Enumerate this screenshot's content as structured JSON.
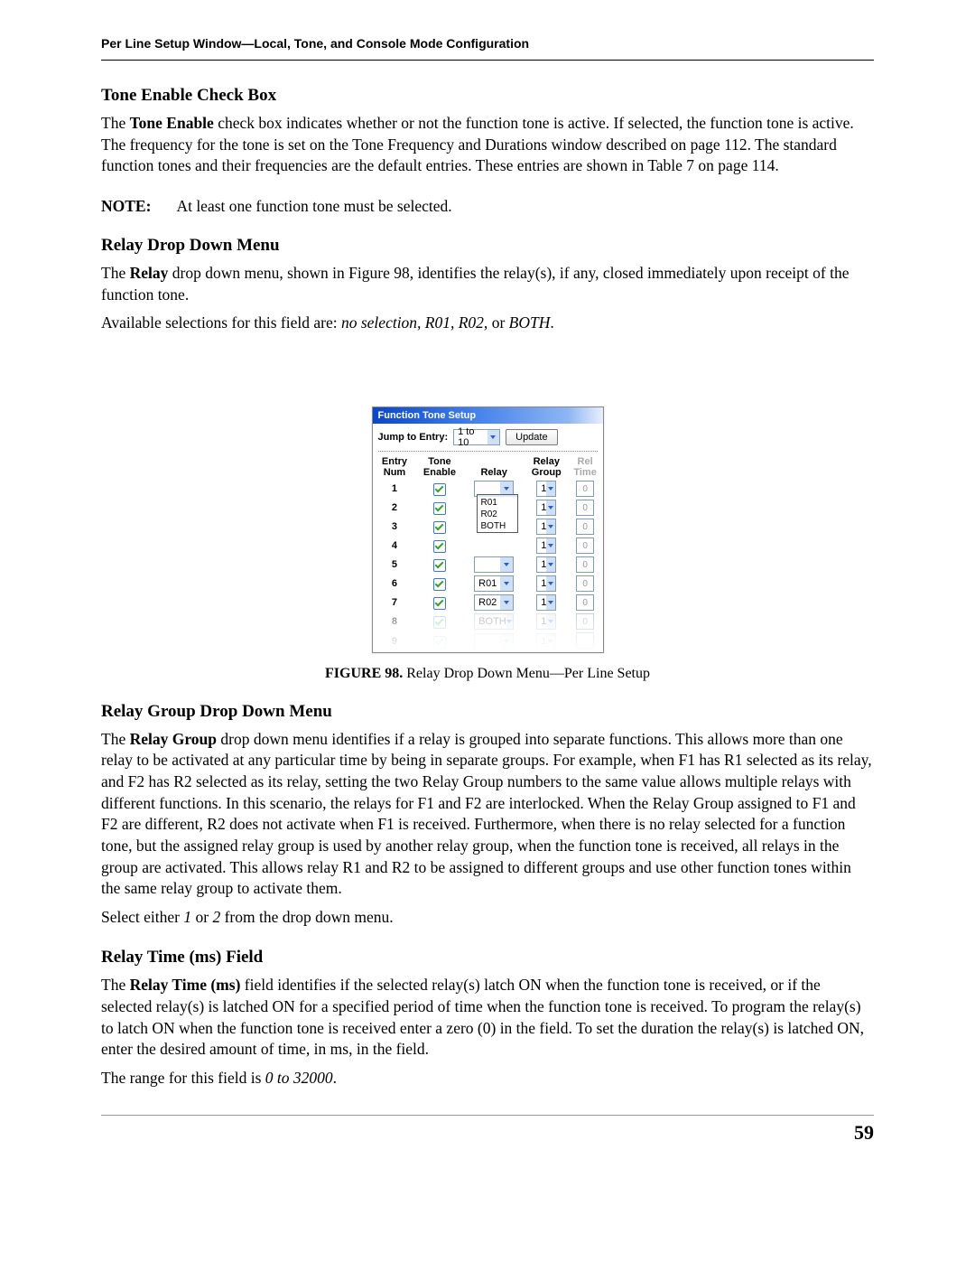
{
  "header": {
    "running_head": "Per Line Setup Window—Local, Tone, and Console Mode Configuration"
  },
  "sections": {
    "tone_enable": {
      "heading": "Tone Enable Check Box",
      "para_pre": "The ",
      "para_bold": "Tone Enable",
      "para_post": " check box indicates whether or not the function tone is active. If selected, the function tone is active. The frequency for the tone is set on the Tone Frequency and Durations window described on page 112. The standard function tones and their frequencies are the default entries. These entries are shown in Table 7 on page 114."
    },
    "note": {
      "label": "NOTE:",
      "text": "At least one function tone must be selected."
    },
    "relay_menu": {
      "heading": "Relay Drop Down Menu",
      "p1_pre": "The ",
      "p1_bold": "Relay",
      "p1_post": " drop down menu, shown in Figure 98, identifies the relay(s), if any, closed immediately upon receipt of the function tone.",
      "p2_pre": "Available selections for this field are: ",
      "p2_it": "no selection, R01, R02,",
      "p2_mid": " or ",
      "p2_it2": "BOTH",
      "p2_end": "."
    },
    "relay_group": {
      "heading": "Relay Group Drop Down Menu",
      "p1_pre": "The ",
      "p1_bold": "Relay Group",
      "p1_post": " drop down menu identifies if a relay is grouped into separate functions. This allows more than one relay to be activated at any particular time by being in separate groups. For example, when F1 has R1 selected as its relay, and F2 has R2 selected as its relay, setting the two Relay Group numbers to the same value allows multiple relays with different functions. In this scenario, the relays for F1 and F2 are interlocked. When the Relay Group assigned to F1 and F2 are different, R2 does not activate when F1 is received. Furthermore, when there is no relay selected for a function tone, but the assigned relay group is used by another relay group, when the function tone is received, all relays in the group are activated. This allows relay R1 and R2 to be assigned to different groups and use other function tones within the same relay group to activate them.",
      "p2_pre": "Select either ",
      "p2_it": "1",
      "p2_mid": " or ",
      "p2_it2": "2",
      "p2_post": " from the drop down menu."
    },
    "relay_time": {
      "heading": "Relay Time (ms) Field",
      "p1_pre": "The ",
      "p1_bold": "Relay Time (ms)",
      "p1_post": " field identifies if the selected relay(s) latch ON when the function tone is received, or if the selected relay(s) is latched ON for a specified period of time when the function tone is received. To program the relay(s) to latch ON when the function tone is received enter a zero (0) in the field. To set the duration the relay(s) is latched ON, enter the desired amount of time, in ms, in the field.",
      "p2_pre": "The range for this field is ",
      "p2_it": "0 to 32000",
      "p2_end": "."
    }
  },
  "figure": {
    "lead": "FIGURE 98.",
    "caption": "  Relay Drop Down Menu—Per Line Setup",
    "app": {
      "title": "Function Tone Setup",
      "jump_label": "Jump to Entry:",
      "jump_value": "1 to 10",
      "update_btn": "Update",
      "columns": {
        "c1a": "Entry",
        "c1b": "Num",
        "c2a": "Tone",
        "c2b": "Enable",
        "c3": "Relay",
        "c4a": "Relay",
        "c4b": "Group",
        "c5a": "Rel",
        "c5b": "Time"
      },
      "open_dropdown": [
        "",
        "R01",
        "R02",
        "BOTH"
      ],
      "rows": [
        {
          "num": "1",
          "relay": "",
          "group": "1",
          "time": "0"
        },
        {
          "num": "2",
          "relay": "",
          "group": "1",
          "time": "0"
        },
        {
          "num": "3",
          "relay": "",
          "group": "1",
          "time": "0"
        },
        {
          "num": "4",
          "relay": "",
          "group": "1",
          "time": "0"
        },
        {
          "num": "5",
          "relay": "",
          "group": "1",
          "time": "0"
        },
        {
          "num": "6",
          "relay": "R01",
          "group": "1",
          "time": "0"
        },
        {
          "num": "7",
          "relay": "R02",
          "group": "1",
          "time": "0"
        },
        {
          "num": "8",
          "relay": "BOTH",
          "group": "1",
          "time": "0"
        },
        {
          "num": "9",
          "relay": "",
          "group": "1",
          "time": ""
        }
      ]
    }
  },
  "footer": {
    "page_num": "59"
  }
}
